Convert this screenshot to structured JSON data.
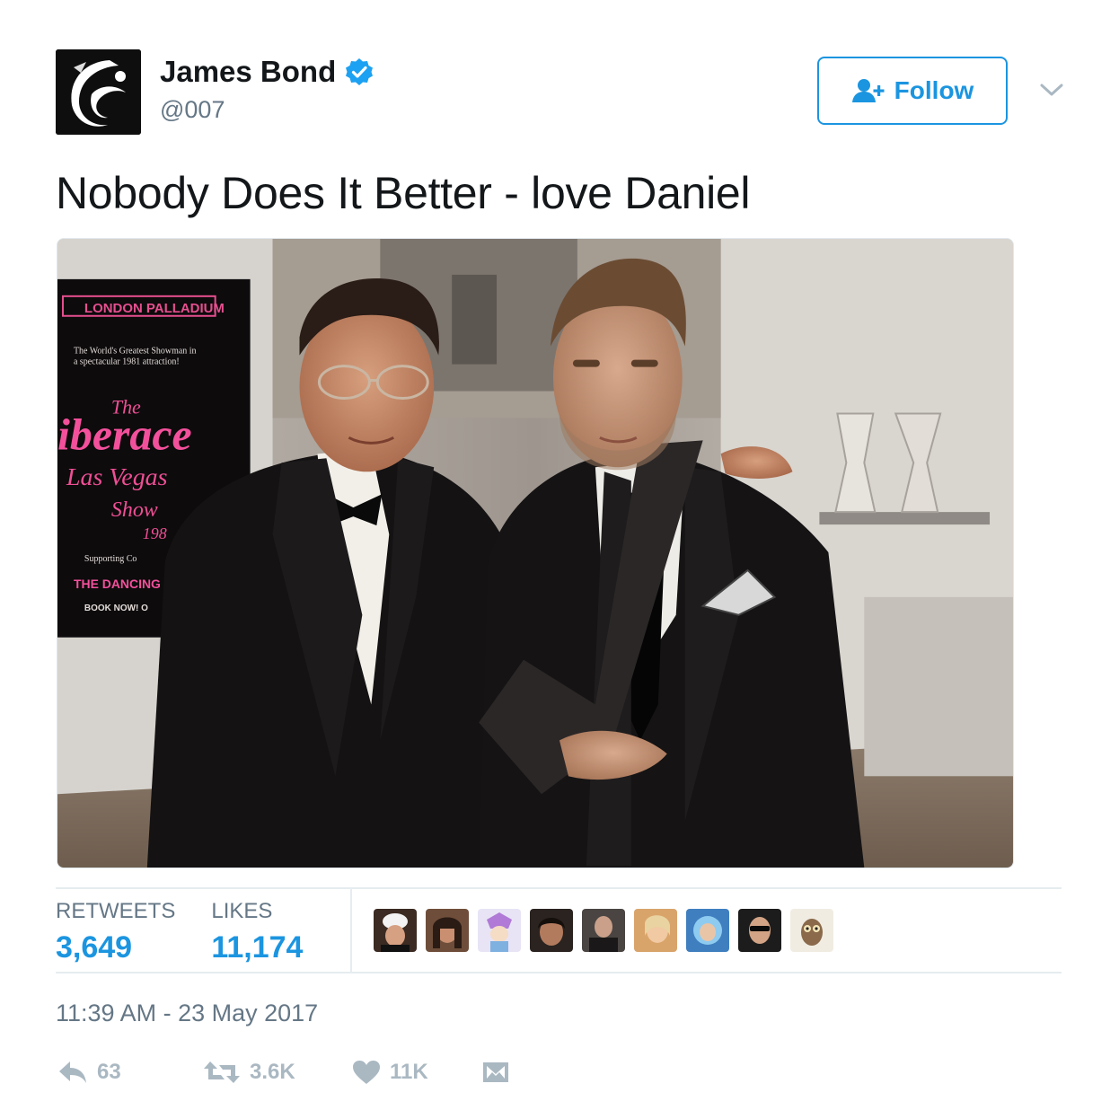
{
  "author": {
    "display_name": "James Bond",
    "handle": "@007",
    "verified": true
  },
  "follow_button": {
    "label": "Follow"
  },
  "tweet": {
    "text": "Nobody Does It Better - love Daniel"
  },
  "media": {
    "poster_lines": [
      "LONDON PALLADIUM",
      "The World's Greatest Showman in",
      "a spectacular 1981 attraction!",
      "The",
      "iberace",
      "Las Vegas",
      "Show",
      "198",
      "Supporting Co",
      "THE DANCING",
      "BOOK NOW! O"
    ]
  },
  "stats": {
    "retweets_label": "RETWEETS",
    "retweets_value": "3,649",
    "likes_label": "LIKES",
    "likes_value": "11,174"
  },
  "likers_count": 9,
  "timestamp": "11:39 AM - 23 May 2017",
  "actions": {
    "reply_count": "63",
    "retweet_count": "3.6K",
    "like_count": "11K"
  },
  "colors": {
    "accent": "#1b95e0",
    "muted": "#657786",
    "action_grey": "#aab8c2",
    "divider": "#e6ecf0"
  },
  "icons": [
    "avatar-007-logo",
    "verified-badge-icon",
    "add-user-icon",
    "chevron-down-icon",
    "reply-icon",
    "retweet-icon",
    "heart-icon",
    "direct-message-icon"
  ]
}
